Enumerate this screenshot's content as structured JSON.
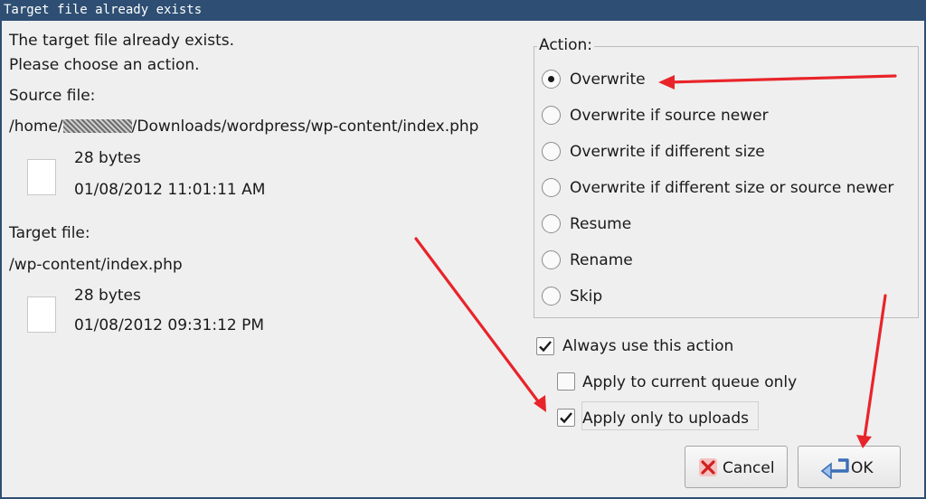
{
  "window": {
    "title": "Target file already exists"
  },
  "message": {
    "line1": "The target file already exists.",
    "line2": "Please choose an action."
  },
  "source": {
    "heading": "Source file:",
    "path_prefix": "/home/",
    "path_suffix": "/Downloads/wordpress/wp-content/index.php",
    "size": "28 bytes",
    "date": "01/08/2012 11:01:11 AM"
  },
  "target": {
    "heading": "Target file:",
    "path": "/wp-content/index.php",
    "size": "28 bytes",
    "date": "01/08/2012 09:31:12 PM"
  },
  "action": {
    "label": "Action:",
    "options": [
      "Overwrite",
      "Overwrite if source newer",
      "Overwrite if different size",
      "Overwrite if different size or source newer",
      "Resume",
      "Rename",
      "Skip"
    ],
    "selected": "Overwrite"
  },
  "checkboxes": {
    "always": {
      "label": "Always use this action",
      "checked": true
    },
    "queue_only": {
      "label": "Apply to current queue only",
      "checked": false
    },
    "uploads_only": {
      "label": "Apply only to uploads",
      "checked": true
    }
  },
  "buttons": {
    "cancel": "Cancel",
    "ok": "OK"
  },
  "colors": {
    "titlebar": "#2e4f73",
    "background": "#efefef",
    "annotation": "#e8242a"
  }
}
